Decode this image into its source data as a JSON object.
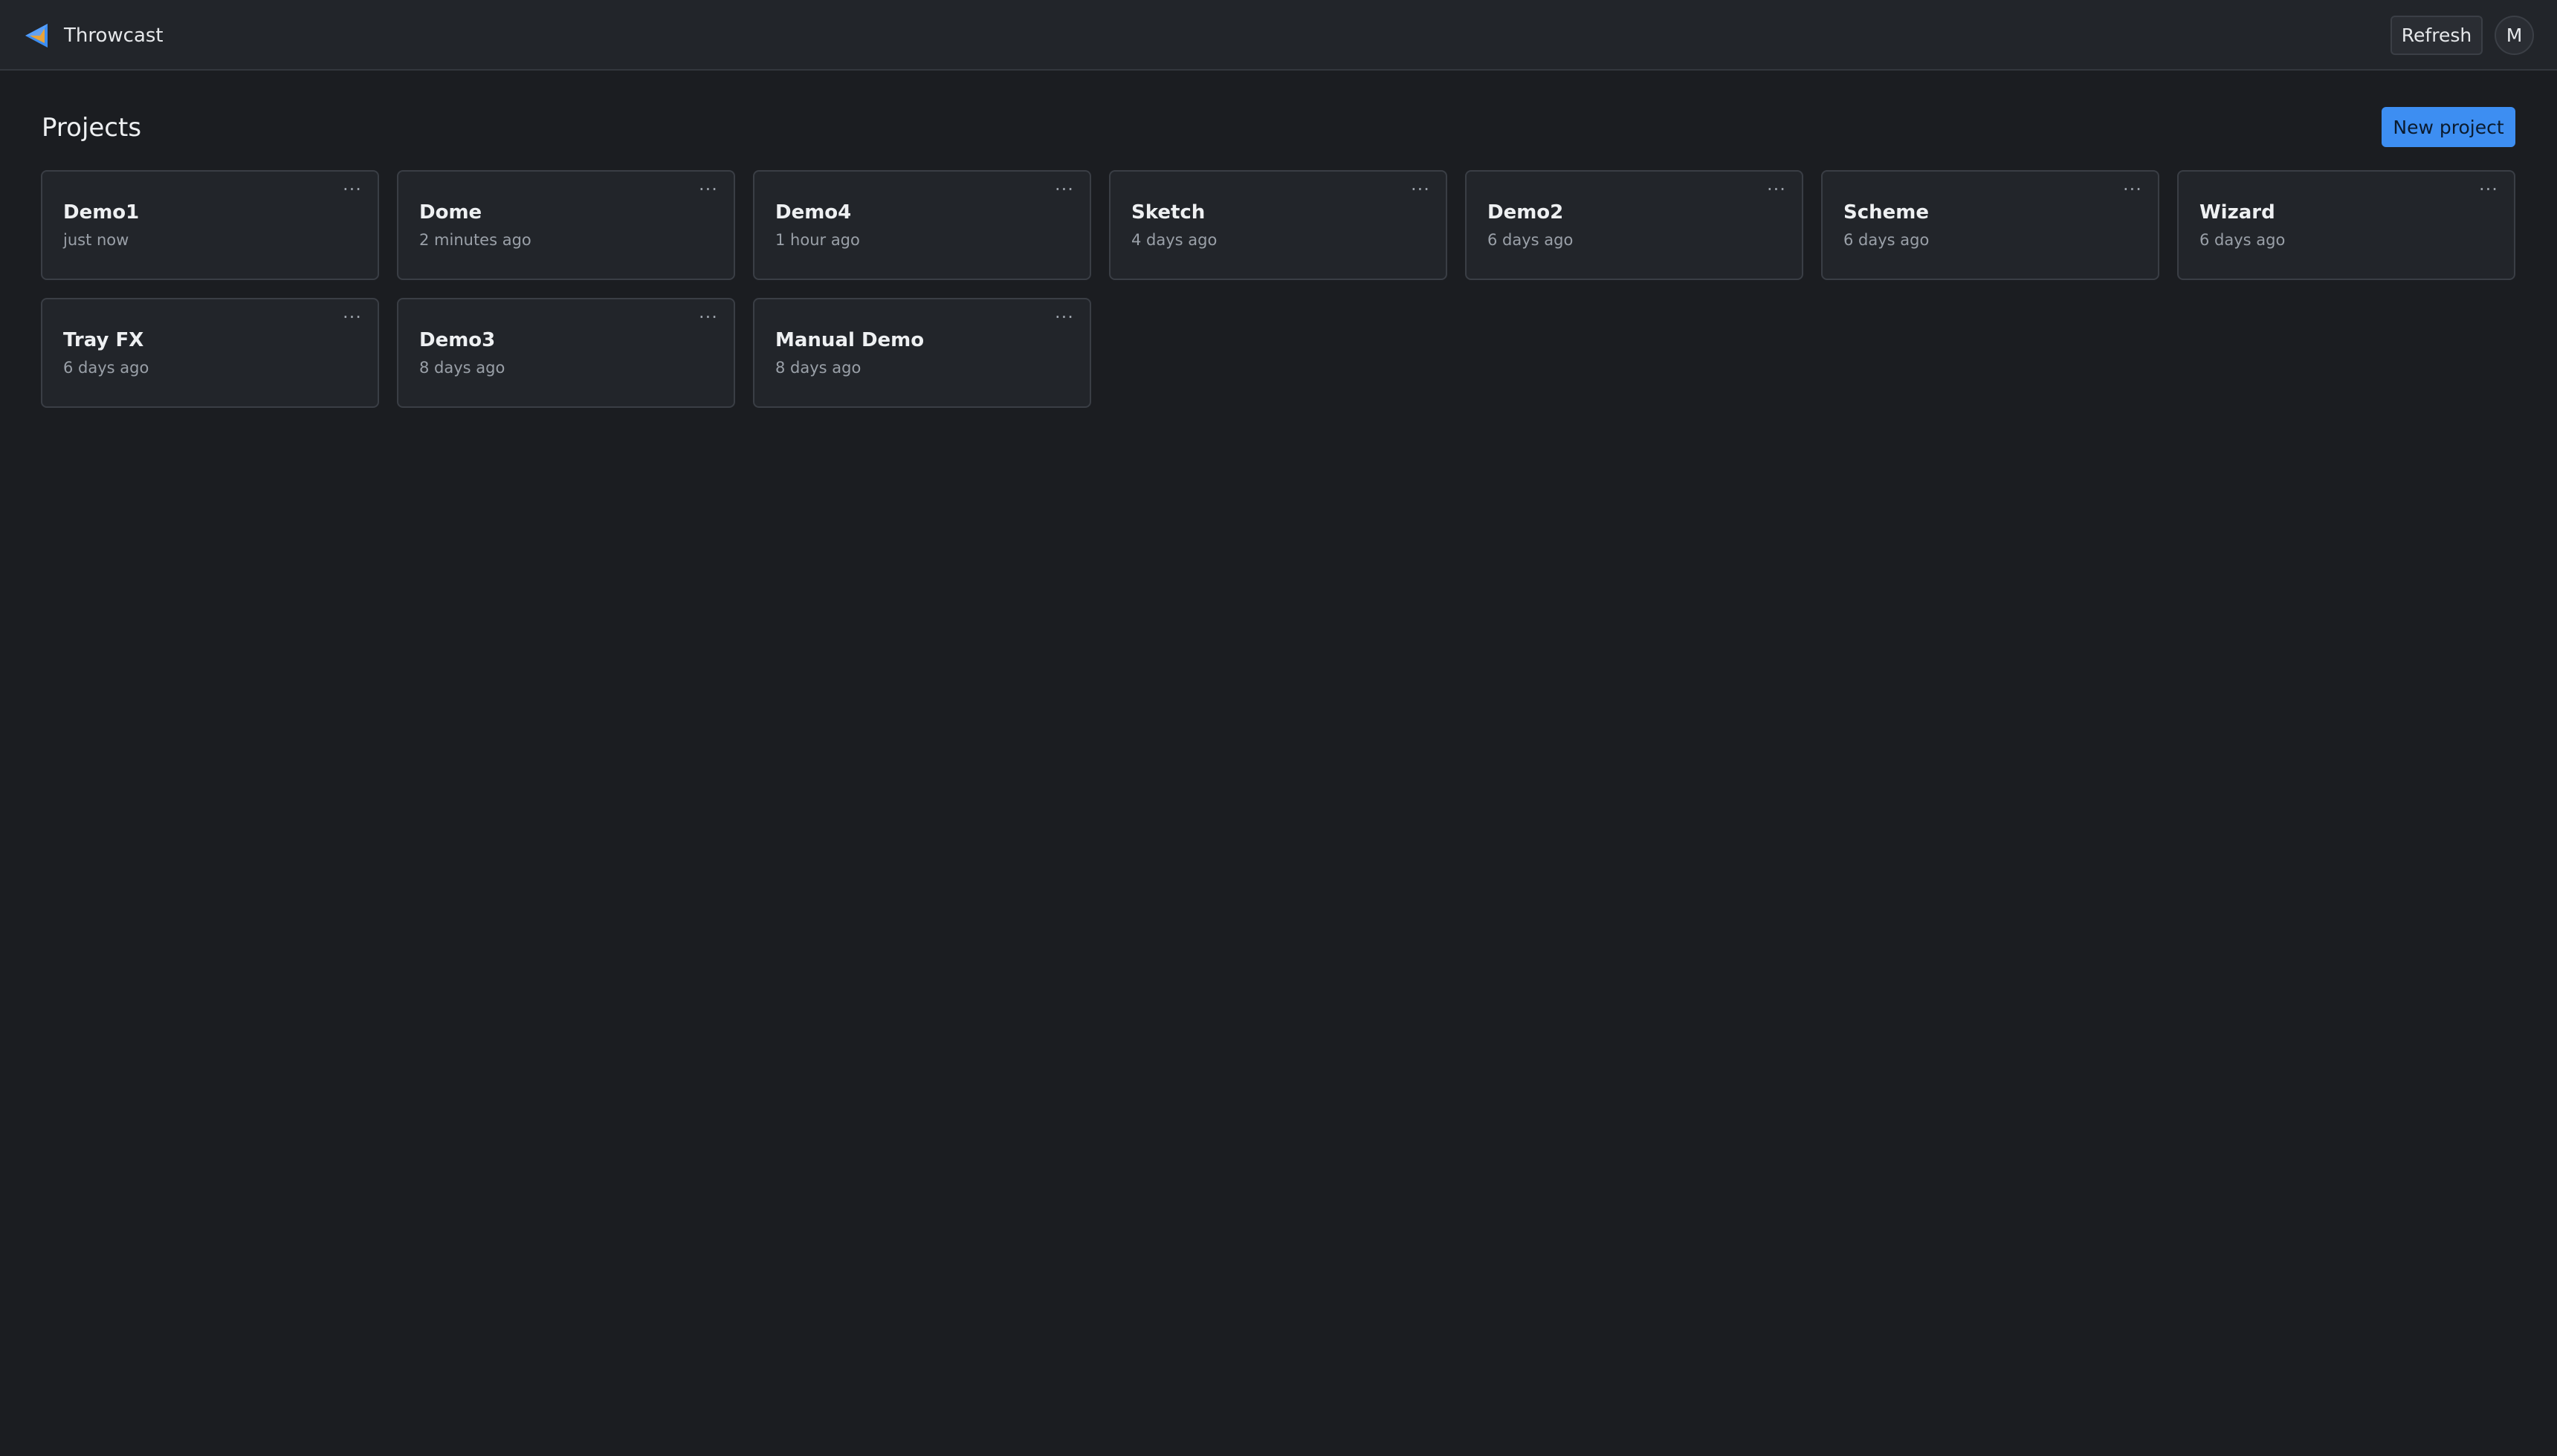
{
  "app": {
    "name": "Throwcast",
    "logo_icon": "throwcast-logo-icon",
    "accent_color": "#3d8ef2"
  },
  "header": {
    "refresh_label": "Refresh",
    "avatar_initial": "M"
  },
  "main": {
    "title": "Projects",
    "new_project_label": "New project",
    "card_menu_icon": "ellipsis-icon",
    "card_menu_glyph": "···",
    "projects": [
      {
        "name": "Demo1",
        "updated": "just now"
      },
      {
        "name": "Dome",
        "updated": "2 minutes ago"
      },
      {
        "name": "Demo4",
        "updated": "1 hour ago"
      },
      {
        "name": "Sketch",
        "updated": "4 days ago"
      },
      {
        "name": "Demo2",
        "updated": "6 days ago"
      },
      {
        "name": "Scheme",
        "updated": "6 days ago"
      },
      {
        "name": "Wizard",
        "updated": "6 days ago"
      },
      {
        "name": "Tray FX",
        "updated": "6 days ago"
      },
      {
        "name": "Demo3",
        "updated": "8 days ago"
      },
      {
        "name": "Manual Demo",
        "updated": "8 days ago"
      }
    ]
  }
}
